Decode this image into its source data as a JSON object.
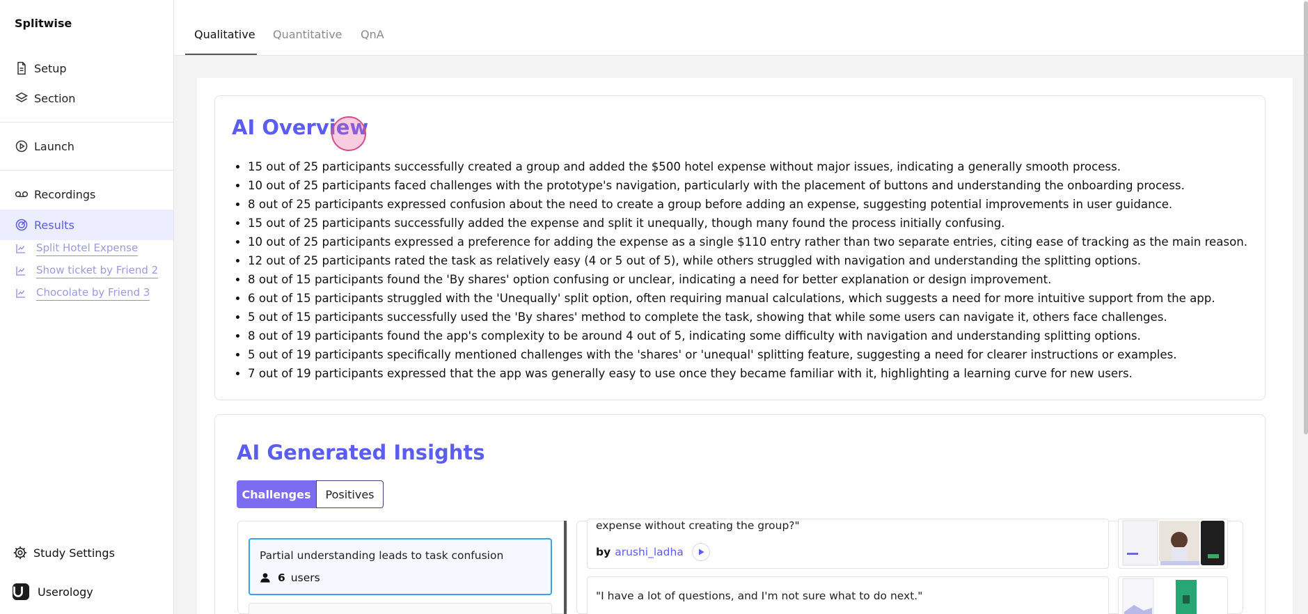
{
  "app": {
    "name": "Splitwise"
  },
  "sidebar": {
    "items": [
      {
        "label": "Setup",
        "icon": "document-icon"
      },
      {
        "label": "Section",
        "icon": "layers-icon"
      },
      {
        "label": "Launch",
        "icon": "play-circle-icon"
      },
      {
        "label": "Recordings",
        "icon": "voicemail-icon"
      },
      {
        "label": "Results",
        "icon": "target-icon",
        "active": true
      }
    ],
    "sub_items": [
      {
        "label": "Split Hotel Expense",
        "icon": "chart-icon"
      },
      {
        "label": "Show ticket by Friend 2",
        "icon": "chart-icon"
      },
      {
        "label": "Chocolate by Friend 3",
        "icon": "chart-icon"
      }
    ],
    "study_settings": "Study Settings",
    "org": "Userology"
  },
  "tabs": [
    {
      "label": "Qualitative",
      "active": true
    },
    {
      "label": "Quantitative"
    },
    {
      "label": "QnA"
    }
  ],
  "overview": {
    "title": "AI Overview",
    "bullets": [
      "15 out of 25 participants successfully created a group and added the $500 hotel expense without major issues, indicating a generally smooth process.",
      "10 out of 25 participants faced challenges with the prototype's navigation, particularly with the placement of buttons and understanding the onboarding process.",
      "8 out of 25 participants expressed confusion about the need to create a group before adding an expense, suggesting potential improvements in user guidance.",
      "15 out of 25 participants successfully added the expense and split it unequally, though many found the process initially confusing.",
      "10 out of 25 participants expressed a preference for adding the expense as a single $110 entry rather than two separate entries, citing ease of tracking as the main reason.",
      "12 out of 25 participants rated the task as relatively easy (4 or 5 out of 5), while others struggled with navigation and understanding the splitting options.",
      "8 out of 15 participants found the 'By shares' option confusing or unclear, indicating a need for better explanation or design improvement.",
      "6 out of 15 participants struggled with the 'Unequally' split option, often requiring manual calculations, which suggests a need for more intuitive support from the app.",
      "5 out of 15 participants successfully used the 'By shares' method to complete the task, showing that while some users can navigate it, others face challenges.",
      "8 out of 19 participants found the app's complexity to be around 4 out of 5, indicating some difficulty with navigation and understanding splitting options.",
      "5 out of 19 participants specifically mentioned challenges with the 'shares' or 'unequal' splitting feature, suggesting a need for clearer instructions or examples.",
      "7 out of 19 participants expressed that the app was generally easy to use once they became familiar with it, highlighting a learning curve for new users."
    ]
  },
  "insights": {
    "title": "AI Generated Insights",
    "segments": [
      "Challenges",
      "Positives"
    ],
    "challenge": {
      "title": "Partial understanding leads to task confusion",
      "count": "6",
      "unit": "users"
    },
    "quotes": [
      {
        "text": "expense without creating the group?\"",
        "by": "by",
        "user": "arushi_ladha"
      },
      {
        "text": "\"I have a lot of questions, and I'm not sure what to do next.\""
      }
    ]
  },
  "colors": {
    "accent": "#5b5cf0",
    "segment_active": "#7b6cf0",
    "selection_border": "#3aa2ea"
  }
}
